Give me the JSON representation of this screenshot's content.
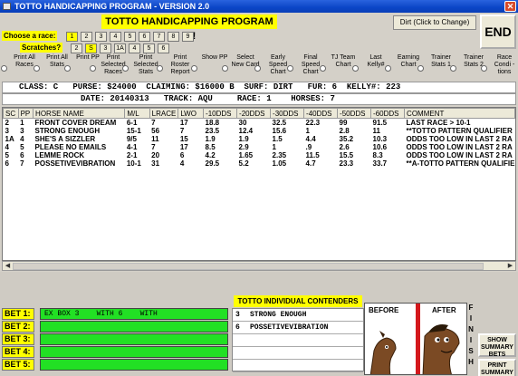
{
  "window": {
    "title": "TOTTO HANDICAPPING PROGRAM - VERSION 2.0",
    "close": "✕"
  },
  "header": {
    "program_title": "TOTTO HANDICAPPING PROGRAM !!!!",
    "surface_button": "Dirt (Click to Change)",
    "end_button": "END",
    "choose_label": "Choose  a race:",
    "scratches_label": "Scratches?",
    "race_buttons": [
      "1",
      "2",
      "3",
      "4",
      "5",
      "6",
      "7",
      "8",
      "9"
    ],
    "selected_race": "1",
    "scratch_buttons": [
      "2",
      "S",
      "3",
      "1A",
      "4",
      "5",
      "6"
    ]
  },
  "options": [
    {
      "label": "Print All Races",
      "type": "radio"
    },
    {
      "label": "Print All Stats",
      "type": "radio"
    },
    {
      "label": "Print PP",
      "type": "radio"
    },
    {
      "label": "Print Selected Races",
      "type": "radio"
    },
    {
      "label": "Print Selected Stats",
      "type": "radio"
    },
    {
      "label": "Print Roster Report",
      "type": "radio"
    },
    {
      "label": "Show PP",
      "type": "radio"
    },
    {
      "label": "Select New Card",
      "type": "radio"
    },
    {
      "label": "Early Speed Chart",
      "type": "radio"
    },
    {
      "label": "Final Speed Chart",
      "type": "radio"
    },
    {
      "label": "TJ Team Chart",
      "type": "radio"
    },
    {
      "label": "Last Kelly#",
      "type": "radio"
    },
    {
      "label": "Earning Chart",
      "type": "radio"
    },
    {
      "label": "Trainer Stats 1",
      "type": "radio"
    },
    {
      "label": "Trainer Stats 2",
      "type": "radio"
    },
    {
      "label": "Race Condi -tions",
      "type": "radio"
    }
  ],
  "race_info": {
    "line1": "CLASS: C   PURSE: $24000  CLAIMING: $16000 B  SURF: DIRT   FUR: 6  KELLY#: 223",
    "line2": "DATE: 20140313   TRACK: AQU     RACE: 1    HORSES: 7"
  },
  "grid": {
    "columns": [
      "SC",
      "PP",
      "HORSE NAME",
      "M/L",
      "LRACE",
      "LWO",
      "-10DDS",
      "-20DDS",
      "-30DDS",
      "-40DDS",
      "-50DDS",
      "-60DDS",
      "COMMENT"
    ],
    "rows": [
      [
        "2",
        "1",
        "FRONT COVER DREAM",
        "6-1",
        "7",
        "17",
        "18.8",
        "30",
        "32.5",
        "22.3",
        "99",
        "91.5",
        "LAST RACE > 10-1"
      ],
      [
        "3",
        "3",
        "STRONG ENOUGH",
        "15-1",
        "56",
        "7",
        "23.5",
        "12.4",
        "15.6",
        "1",
        "2.8",
        "11",
        "**TOTTO PATTERN QUALIFIER"
      ],
      [
        "1A",
        "4",
        "SHE'S A SIZZLER",
        "9/5",
        "11",
        "15",
        "1.9",
        "1.9",
        "1.5",
        "4.4",
        "35.2",
        "10.3",
        "ODDS TOO LOW IN LAST 2 RA"
      ],
      [
        "4",
        "5",
        "PLEASE NO EMAILS",
        "4-1",
        "7",
        "17",
        "8.5",
        "2.9",
        "1",
        ".9",
        "2.6",
        "10.6",
        "ODDS TOO LOW IN LAST 2 RA"
      ],
      [
        "5",
        "6",
        "LEMME ROCK",
        "2-1",
        "20",
        "6",
        "4.2",
        "1.65",
        "2.35",
        "11.5",
        "15.5",
        "8.3",
        "ODDS TOO LOW IN LAST 2 RA"
      ],
      [
        "6",
        "7",
        "POSSETIVEVIBRATION",
        "10-1",
        "31",
        "4",
        "29.5",
        "5.2",
        "1.05",
        "4.7",
        "23.3",
        "33.7",
        "**A-TOTTO PATTERN QUALIFIE"
      ]
    ]
  },
  "bets": [
    {
      "label": "BET 1:",
      "value": "EX BOX 3    WITH 6    WITH"
    },
    {
      "label": "BET 2:",
      "value": ""
    },
    {
      "label": "BET 3:",
      "value": ""
    },
    {
      "label": "BET 4:",
      "value": ""
    },
    {
      "label": "BET 5:",
      "value": ""
    }
  ],
  "contenders": {
    "title": "TOTTO INDIVIDUAL CONTENDERS",
    "items": [
      {
        "pp": "3",
        "name": "STRONG ENOUGH"
      },
      {
        "pp": "6",
        "name": "POSSETIVEVIBRATION"
      },
      {
        "pp": "",
        "name": ""
      },
      {
        "pp": "",
        "name": ""
      },
      {
        "pp": "",
        "name": ""
      }
    ]
  },
  "picture": {
    "before": "BEFORE",
    "after": "AFTER",
    "finish": [
      "F",
      "I",
      "N",
      "I",
      "S",
      "H"
    ]
  },
  "side_buttons": {
    "summary": "SHOW SUMMARY BETS",
    "print_summary": "PRINT SUMMARY BET SHEET"
  },
  "colors": {
    "title_yellow": "#ffff00",
    "bet_green": "#22e024",
    "titlebar_blue": "#0b45c6"
  }
}
